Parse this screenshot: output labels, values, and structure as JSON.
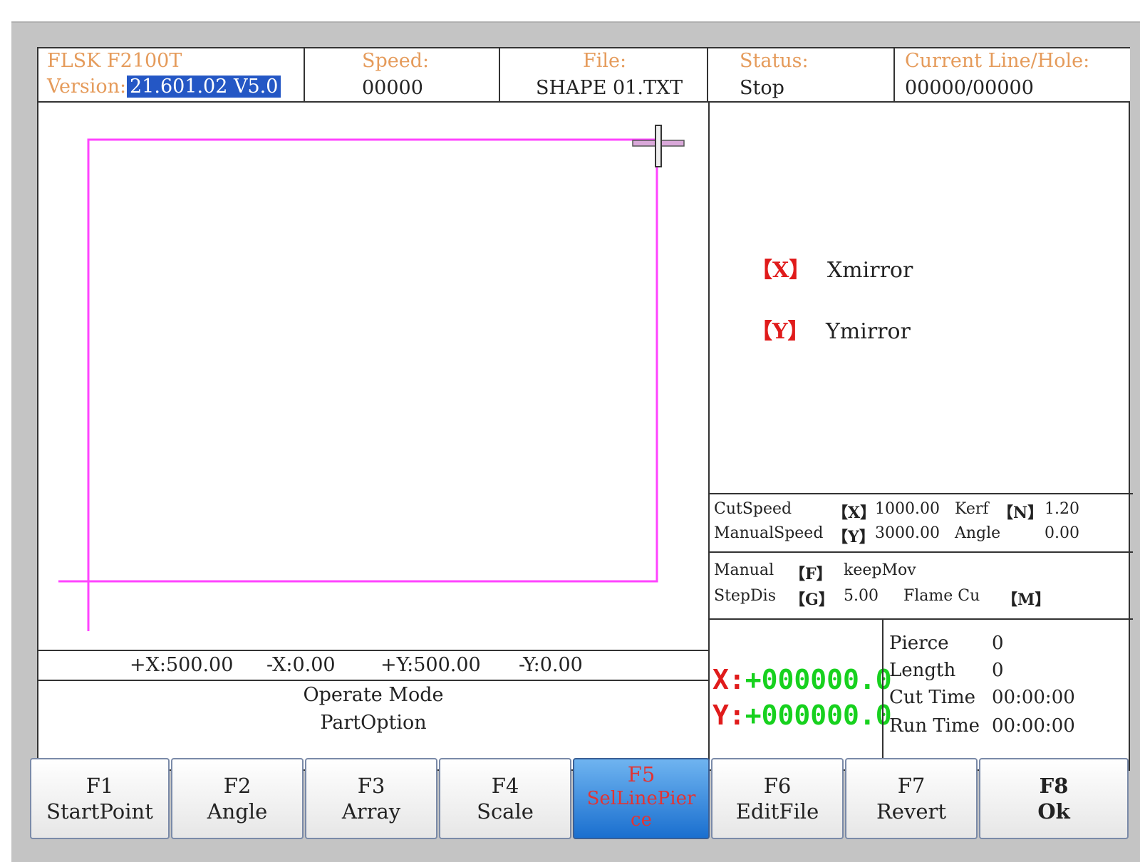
{
  "header": {
    "product": "FLSK F2100T",
    "version_label": "Version:",
    "version_value": "21.601.02 V5.0",
    "speed_label": "Speed:",
    "speed_value": "00000",
    "file_label": "File:",
    "file_value": "SHAPE 01.TXT",
    "status_label": "Status:",
    "status_value": "Stop",
    "line_label": "Current Line/Hole:",
    "line_value": "00000/00000"
  },
  "mirror": {
    "x_key": "【X】",
    "x_label": "Xmirror",
    "y_key": "【Y】",
    "y_label": "Ymirror"
  },
  "speeds": {
    "cut_label": "CutSpeed",
    "cut_key": "【X】",
    "cut_value": "1000.00",
    "kerf_label": "Kerf",
    "kerf_key": "【N】",
    "kerf_value": "1.20",
    "manual_label": "ManualSpeed",
    "manual_key": "【Y】",
    "manual_value": "3000.00",
    "angle_label": "Angle",
    "angle_value": "0.00"
  },
  "mode": {
    "manual_label": "Manual",
    "manual_key": "【F】",
    "manual_value": "keepMov",
    "step_label": "StepDis",
    "step_key": "【G】",
    "step_value": "5.00",
    "flame_label": "Flame Cu",
    "flame_key": "【M】"
  },
  "position": {
    "x": "X:+000000.0",
    "y": "Y:+000000.0"
  },
  "stats": {
    "pierce_label": "Pierce",
    "pierce_value": "0",
    "length_label": "Length",
    "length_value": "0",
    "cut_time_label": "Cut Time",
    "cut_time_value": "00:00:00",
    "run_time_label": "Run Time",
    "run_time_value": "00:00:00"
  },
  "limits": {
    "plus_x": "+X:500.00",
    "minus_x": "-X:0.00",
    "plus_y": "+Y:500.00",
    "minus_y": "-Y:0.00"
  },
  "operate": {
    "line1": "Operate Mode",
    "line2": "PartOption"
  },
  "fkeys": [
    {
      "key": "F1",
      "label": "StartPoint"
    },
    {
      "key": "F2",
      "label": "Angle"
    },
    {
      "key": "F3",
      "label": "Array"
    },
    {
      "key": "F4",
      "label": "Scale"
    },
    {
      "key": "F5",
      "label": "SelLinePierce"
    },
    {
      "key": "F6",
      "label": "EditFile"
    },
    {
      "key": "F7",
      "label": "Revert"
    },
    {
      "key": "F8",
      "label": "Ok"
    }
  ],
  "colors": {
    "shape": "#ff44ff",
    "accent": "#2457c5",
    "position": "#17d11e",
    "key": "#e01b1b"
  }
}
